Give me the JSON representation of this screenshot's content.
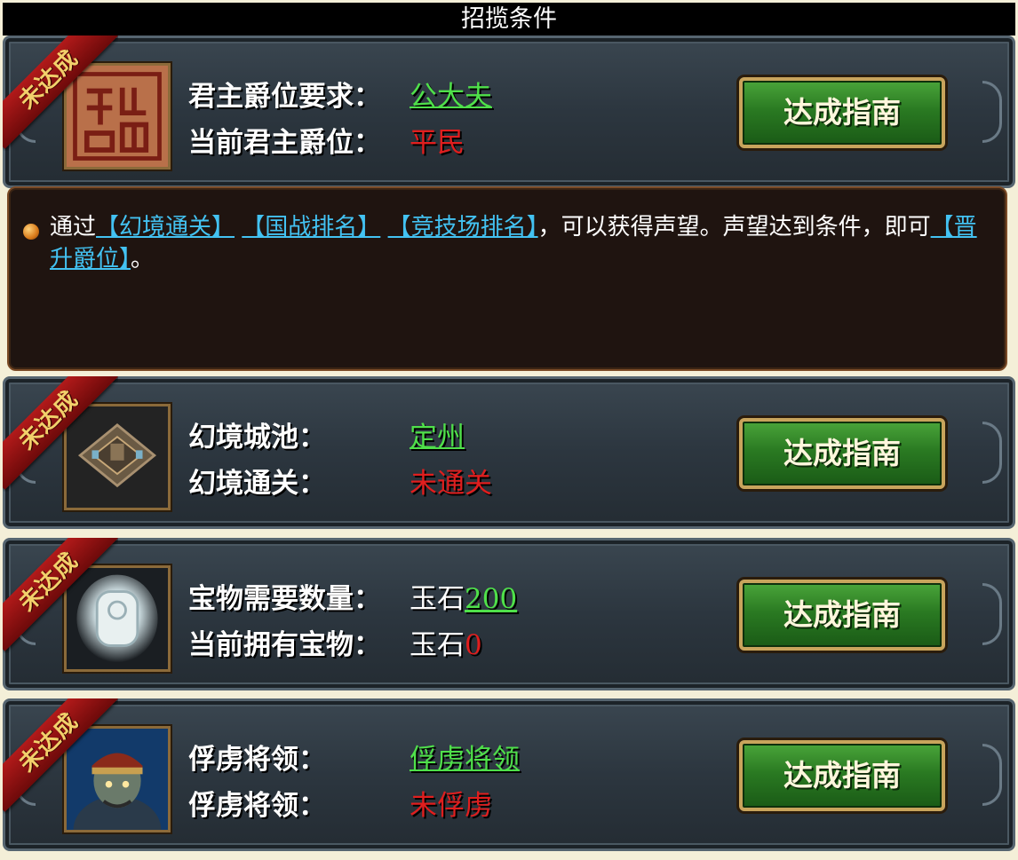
{
  "title": "招揽条件",
  "ribbon_text": "未达成",
  "button_label": "达成指南",
  "sections": [
    {
      "icon": "seal-icon",
      "row1_label": "君主爵位要求：",
      "row1_value": "公大夫",
      "row2_label": "当前君主爵位：",
      "row2_value": "平民"
    },
    {
      "icon": "city-icon",
      "row1_label": "幻境城池：",
      "row1_value": "定州",
      "row2_label": "幻境通关：",
      "row2_value": "未通关"
    },
    {
      "icon": "jade-icon",
      "row1_label": "宝物需要数量：",
      "row1_prefix": "玉石",
      "row1_value": "200",
      "row2_label": "当前拥有宝物：",
      "row2_prefix": "玉石",
      "row2_value": "0"
    },
    {
      "icon": "general-portrait-icon",
      "row1_label": "俘虏将领：",
      "row1_value": "俘虏将领",
      "row2_label": "俘虏将领：",
      "row2_value": "未俘虏"
    }
  ],
  "info": {
    "t1": "通过",
    "link1": "【幻境通关】",
    "sp1": " ",
    "link2": "【国战排名】",
    "sp2": " ",
    "link3": "【竞技场排名】",
    "t2": "，可以获得声望。声望达到条件，即可",
    "link4": "【晋升爵位】",
    "t3": "。"
  },
  "colors": {
    "met": "#4fe04a",
    "unmet": "#e01e1e",
    "link": "#43c2f2",
    "button": "#2a7a22"
  }
}
